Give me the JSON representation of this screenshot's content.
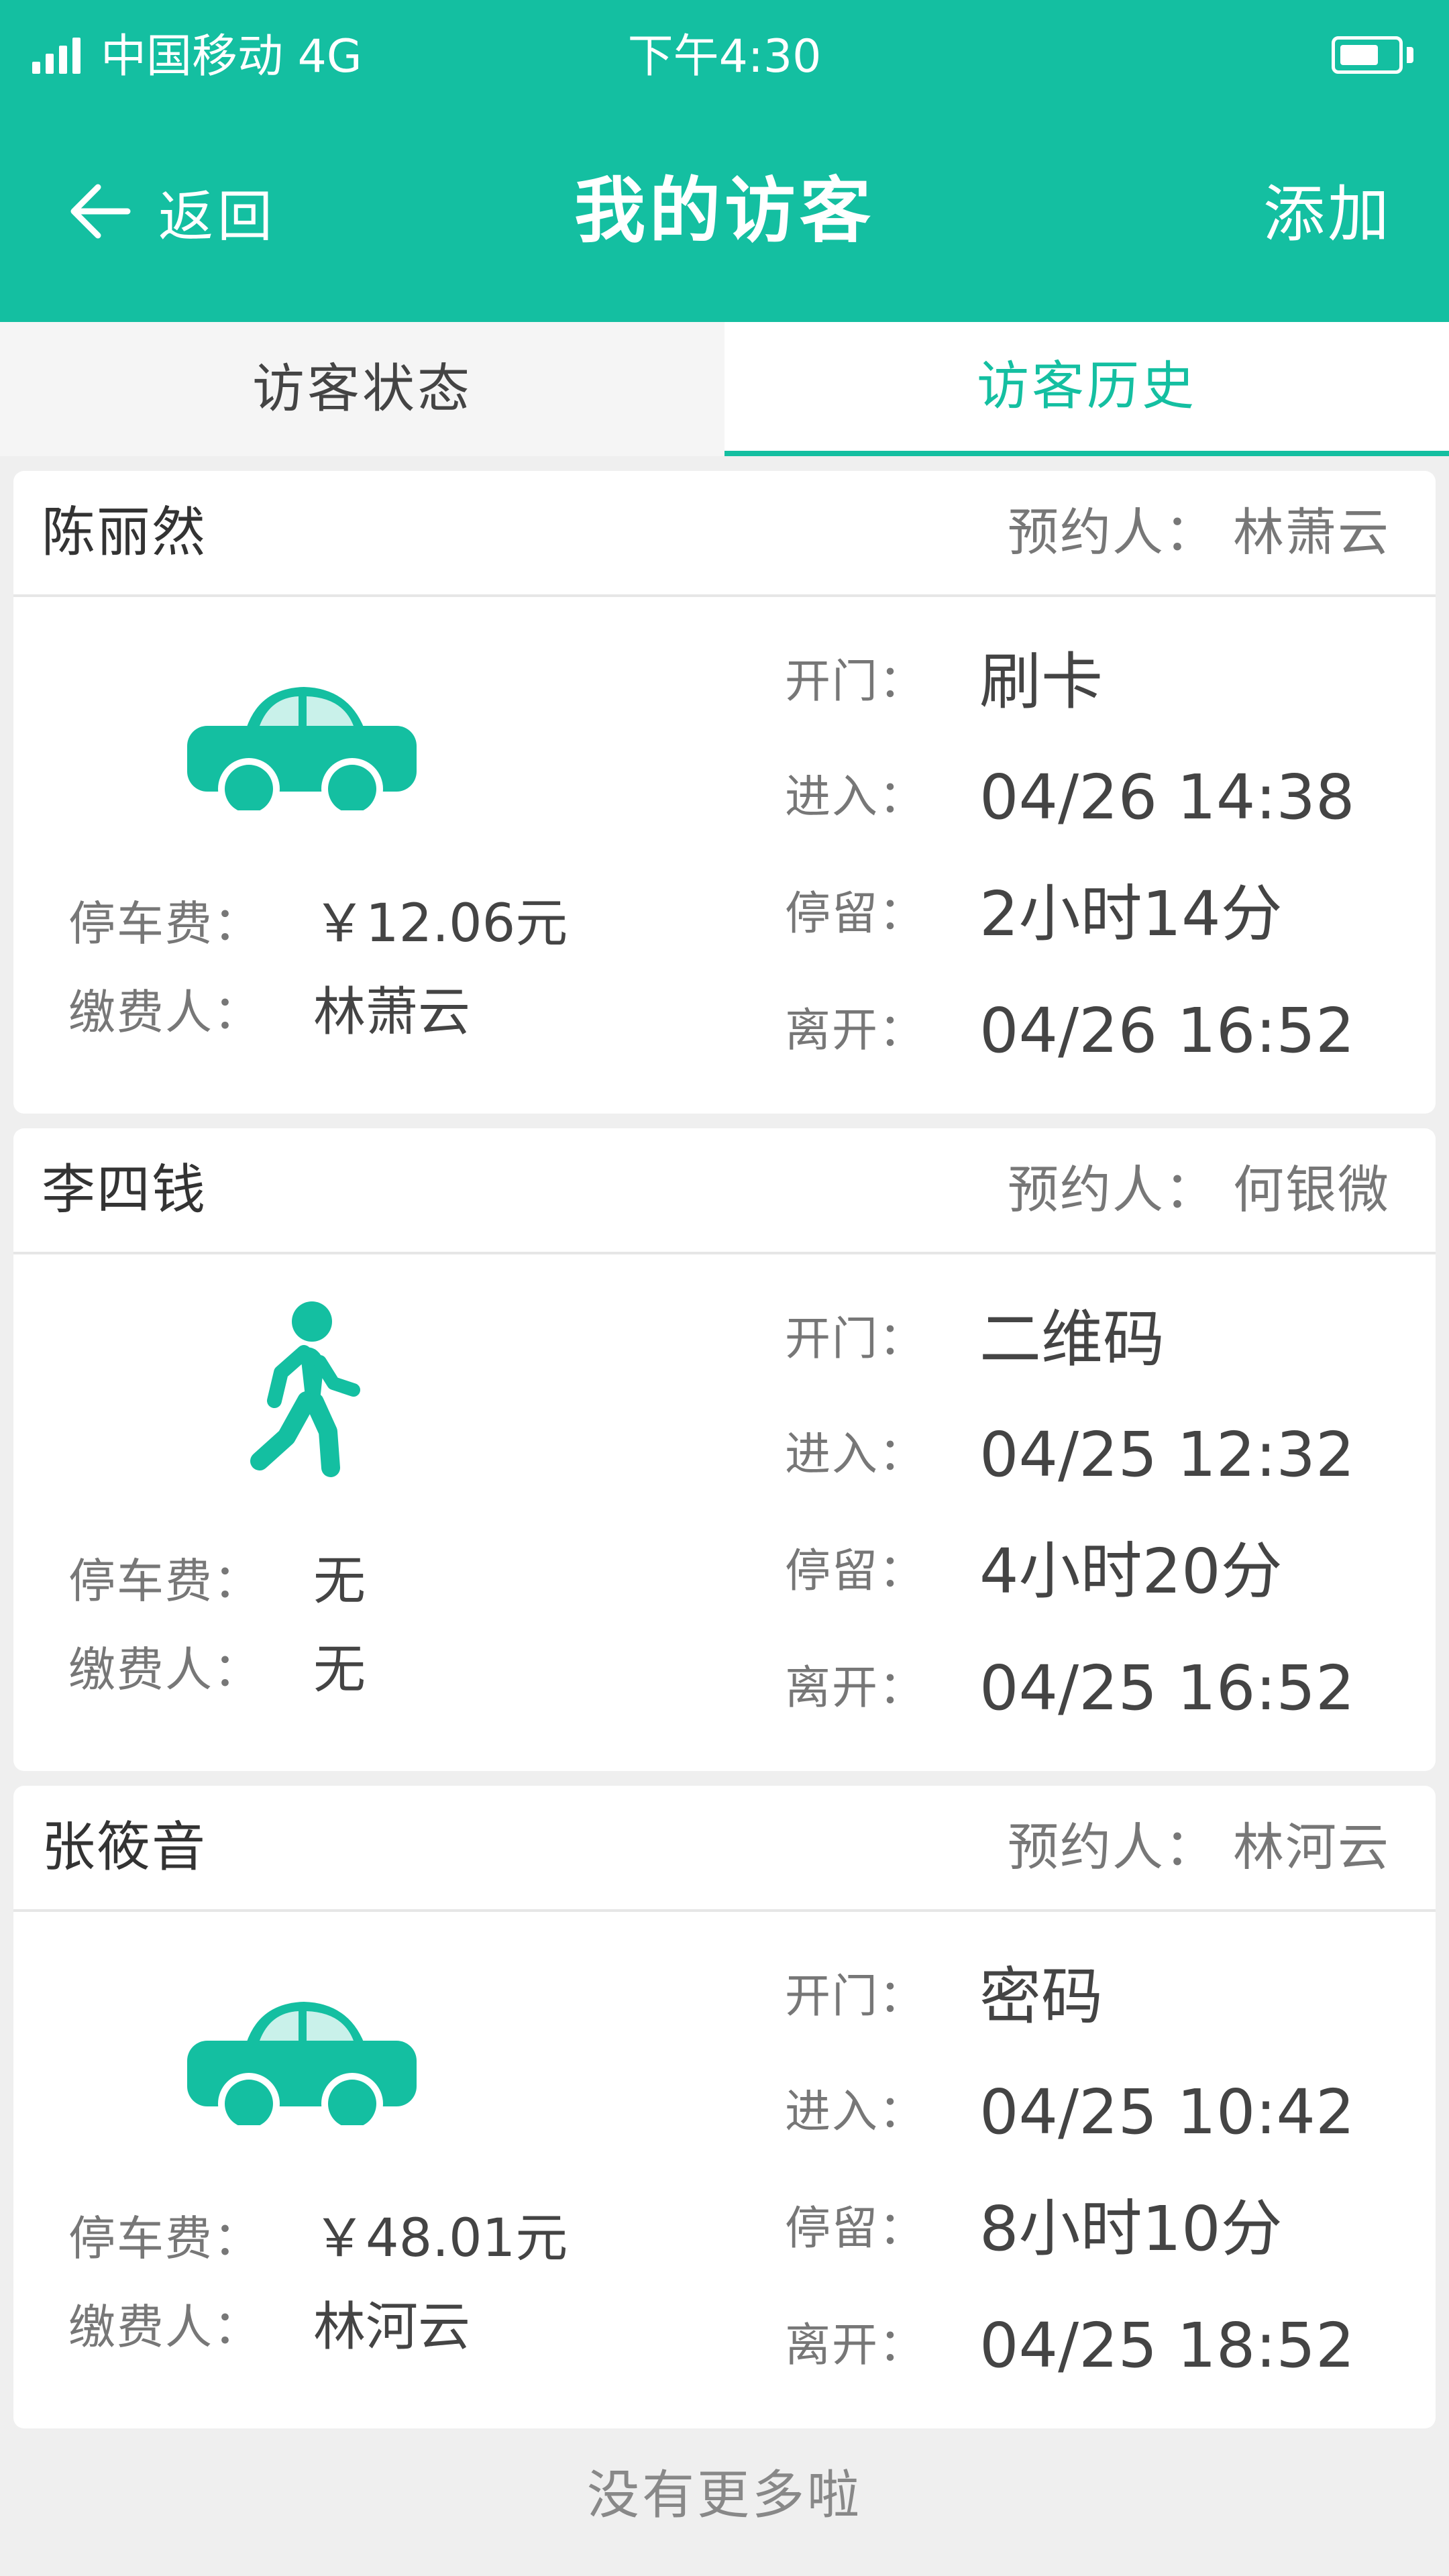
{
  "status_bar": {
    "carrier": "中国移动  4G",
    "time": "下午4:30",
    "battery_level": 0.7
  },
  "header": {
    "back_label": "返回",
    "title": "我的访客",
    "add_label": "添加"
  },
  "tabs": [
    {
      "label": "访客状态",
      "active": false
    },
    {
      "label": "访客历史",
      "active": true
    }
  ],
  "labels": {
    "booker": "预约人：",
    "parking_fee": "停车费：",
    "payer": "缴费人：",
    "open_door": "开门：",
    "enter": "进入：",
    "stay": "停留：",
    "leave": "离开："
  },
  "visits": [
    {
      "visitor": "陈丽然",
      "booker": "林萧云",
      "mode": "car",
      "icon": "car-icon",
      "parking_fee": "￥12.06元",
      "payer": "林萧云",
      "open_door": "刷卡",
      "enter": "04/26   14:38",
      "stay": "2小时14分",
      "leave": "04/26   16:52"
    },
    {
      "visitor": "李四钱",
      "booker": "何银微",
      "mode": "walk",
      "icon": "walking-person-icon",
      "parking_fee": "无",
      "payer": "无",
      "open_door": "二维码",
      "enter": "04/25   12:32",
      "stay": "4小时20分",
      "leave": "04/25   16:52"
    },
    {
      "visitor": "张筱音",
      "booker": "林河云",
      "mode": "car",
      "icon": "car-icon",
      "parking_fee": "￥48.01元",
      "payer": "林河云",
      "open_door": "密码",
      "enter": "04/25   10:42",
      "stay": "8小时10分",
      "leave": "04/25   18:52"
    }
  ],
  "footer": "没有更多啦",
  "colors": {
    "primary": "#14bfa1",
    "background": "#efefef",
    "card": "#ffffff"
  }
}
